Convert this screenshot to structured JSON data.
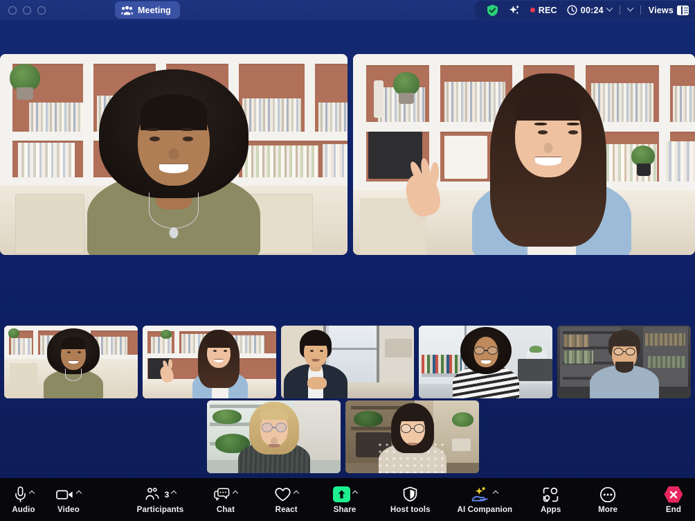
{
  "window": {
    "traffic_lights": [
      "close",
      "minimize",
      "maximize"
    ],
    "title_pill": {
      "label": "Meeting",
      "icon": "participants-group-icon"
    }
  },
  "topbar": {
    "encryption_icon": "shield-check-icon",
    "ai_icon": "sparkle-icon",
    "recording": {
      "label": "REC",
      "dot_color": "#ef3a4e"
    },
    "timer": {
      "icon": "clock-icon",
      "value": "00:24",
      "chevron": "chevron-down-icon"
    },
    "more_chevron": "chevron-down-icon",
    "views": {
      "label": "Views",
      "icon": "layout-view-icon"
    },
    "colors": {
      "bar_bg": "#1a2f76",
      "pill_bg": "#3a52a4",
      "right_bg": "#16296b"
    }
  },
  "stage": {
    "tiles": [
      {
        "name": "speaker-tile-1",
        "person": "woman-curly-hair-olive-shirt"
      },
      {
        "name": "speaker-tile-2",
        "person": "woman-denim-shirt-waving"
      }
    ]
  },
  "filmstrip": {
    "row1": [
      {
        "name": "thumbnail-1",
        "person": "woman-curly-hair-olive-shirt"
      },
      {
        "name": "thumbnail-2",
        "person": "woman-denim-shirt-waving"
      },
      {
        "name": "thumbnail-3",
        "person": "man-dark-blazer"
      },
      {
        "name": "thumbnail-4",
        "person": "woman-glasses-striped-shirt"
      },
      {
        "name": "thumbnail-5",
        "person": "man-beard-glasses-blue-shirt"
      }
    ],
    "row2": [
      {
        "name": "thumbnail-6",
        "person": "blonde-woman-glasses"
      },
      {
        "name": "thumbnail-7",
        "person": "woman-glasses-patterned-top"
      }
    ]
  },
  "toolbar": {
    "background": "#08080c",
    "items": [
      {
        "label": "Audio",
        "icon": "microphone-icon",
        "caret": true,
        "badge": null
      },
      {
        "label": "Video",
        "icon": "video-camera-icon",
        "caret": true,
        "badge": null
      },
      {
        "label": "Participants",
        "icon": "participants-icon",
        "caret": true,
        "badge": "3"
      },
      {
        "label": "Chat",
        "icon": "chat-bubble-icon",
        "caret": true,
        "badge": null
      },
      {
        "label": "React",
        "icon": "heart-icon",
        "caret": true,
        "badge": null
      },
      {
        "label": "Share",
        "icon": "share-screen-icon",
        "caret": true,
        "badge": null
      },
      {
        "label": "Host tools",
        "icon": "shield-icon",
        "caret": false,
        "badge": null
      },
      {
        "label": "AI Companion",
        "icon": "ai-companion-icon",
        "caret": true,
        "badge": null
      },
      {
        "label": "Apps",
        "icon": "apps-icon",
        "caret": false,
        "badge": null
      },
      {
        "label": "More",
        "icon": "more-dots-icon",
        "caret": false,
        "badge": null
      },
      {
        "label": "End",
        "icon": "end-call-icon",
        "caret": false,
        "badge": null
      }
    ],
    "accent_colors": {
      "share_green": "#1df08f",
      "end_red": "#e8265e",
      "ai_yellow": "#f5d02e",
      "ai_blue": "#5b7fe0"
    }
  }
}
